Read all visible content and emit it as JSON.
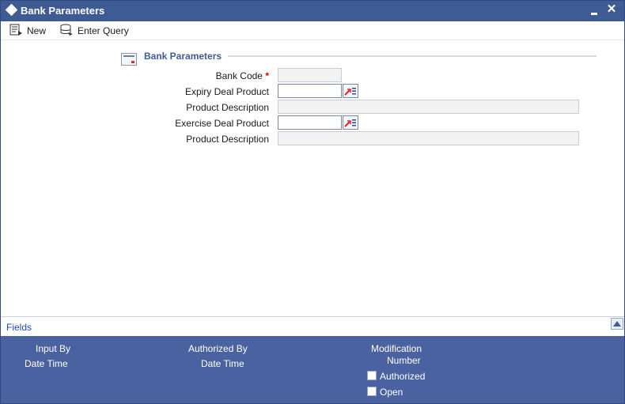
{
  "window": {
    "title": "Bank Parameters"
  },
  "toolbar": {
    "new_label": "New",
    "enter_query_label": "Enter Query"
  },
  "section": {
    "title": "Bank Parameters"
  },
  "form": {
    "bank_code_label": "Bank Code",
    "required_marker": "*",
    "bank_code_value": "",
    "expiry_deal_product_label": "Expiry Deal Product",
    "expiry_deal_product_value": "",
    "product_description_label_1": "Product Description",
    "product_description_value_1": "",
    "exercise_deal_product_label": "Exercise Deal Product",
    "exercise_deal_product_value": "",
    "product_description_label_2": "Product Description",
    "product_description_value_2": ""
  },
  "fields_bar": {
    "label": "Fields"
  },
  "footer": {
    "input_by": "Input By",
    "date_time_1": "Date Time",
    "authorized_by": "Authorized By",
    "date_time_2": "Date Time",
    "modification": "Modification",
    "number": "Number",
    "authorized": "Authorized",
    "open": "Open"
  },
  "colors": {
    "titlebar": "#3e5b93",
    "footer": "#4a62a0",
    "accent": "#2448a3",
    "required": "#cc0000"
  }
}
